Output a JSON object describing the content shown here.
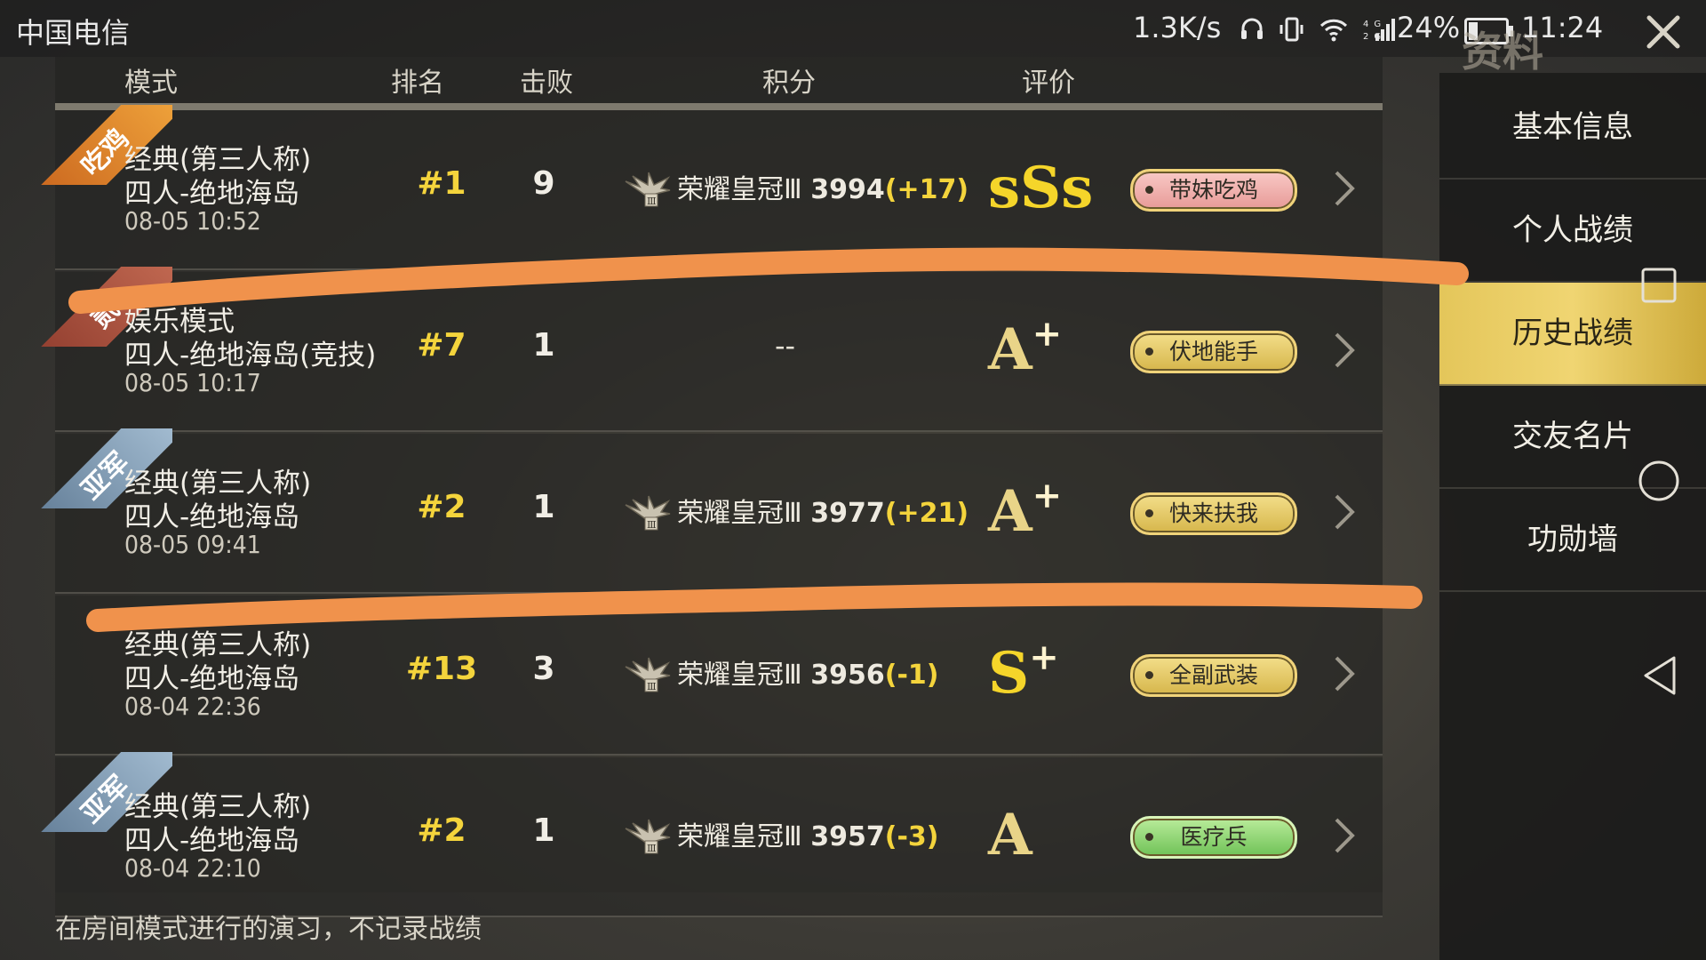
{
  "statusbar": {
    "carrier": "中国电信",
    "net_speed": "1.3K/s",
    "battery": "24%",
    "battery_level": 0.24,
    "time": "11:24",
    "title_bg": "资料"
  },
  "table": {
    "headers": {
      "mode": "模式",
      "rank": "排名",
      "kills": "击败",
      "score": "积分",
      "rating": "评价"
    },
    "rows": [
      {
        "ribbon": "吃鸡",
        "mode_line1": "经典(第三人称)",
        "mode_line2": "四人-绝地海岛",
        "time": "08-05 10:52",
        "rank": "#1",
        "kills": "9",
        "tier": "荣耀皇冠Ⅲ",
        "score": "3994",
        "delta": "(+17)",
        "grade": "sSs",
        "grade_plus": "",
        "badge": "带妹吃鸡"
      },
      {
        "ribbon": "贰",
        "mode_line1": "娱乐模式",
        "mode_line2": "四人-绝地海岛(竞技)",
        "time": "08-05 10:17",
        "rank": "#7",
        "kills": "1",
        "score_empty": "--",
        "grade": "A",
        "grade_plus": "+",
        "badge": "伏地能手"
      },
      {
        "ribbon": "亚军",
        "mode_line1": "经典(第三人称)",
        "mode_line2": "四人-绝地海岛",
        "time": "08-05 09:41",
        "rank": "#2",
        "kills": "1",
        "tier": "荣耀皇冠Ⅲ",
        "score": "3977",
        "delta": "(+21)",
        "grade": "A",
        "grade_plus": "+",
        "badge": "快来扶我"
      },
      {
        "ribbon": "",
        "mode_line1": "经典(第三人称)",
        "mode_line2": "四人-绝地海岛",
        "time": "08-04 22:36",
        "rank": "#13",
        "kills": "3",
        "tier": "荣耀皇冠Ⅲ",
        "score": "3956",
        "delta": "(-1)",
        "grade": "S",
        "grade_plus": "+",
        "badge": "全副武装"
      },
      {
        "ribbon": "亚军",
        "mode_line1": "经典(第三人称)",
        "mode_line2": "四人-绝地海岛",
        "time": "08-04 22:10",
        "rank": "#2",
        "kills": "1",
        "tier": "荣耀皇冠Ⅲ",
        "score": "3957",
        "delta": "(-3)",
        "grade": "A",
        "grade_plus": "",
        "badge": "医疗兵"
      }
    ],
    "footnote": "在房间模式进行的演习，不记录战绩"
  },
  "sidebar": {
    "items": [
      {
        "label": "基本信息",
        "active": false
      },
      {
        "label": "个人战绩",
        "active": false
      },
      {
        "label": "历史战绩",
        "active": true
      },
      {
        "label": "交友名片",
        "active": false
      },
      {
        "label": "功勋墙",
        "active": false
      }
    ]
  },
  "colors": {
    "accent_gold": "#f4d43c",
    "scribble_orange": "#f0924c",
    "active_menu": "#e8c95e"
  }
}
